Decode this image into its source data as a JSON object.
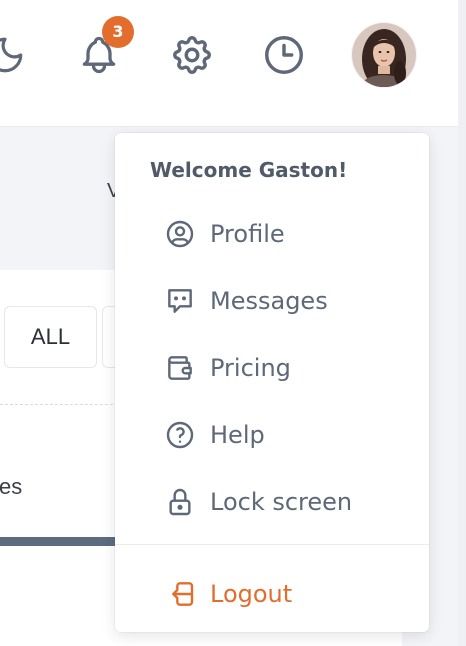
{
  "header": {
    "notifications_count": "3",
    "icons": [
      "moon-icon",
      "bell-icon",
      "gear-icon",
      "clock-icon"
    ],
    "accent_color": "#e36d2d"
  },
  "background": {
    "filter_all_label": "ALL",
    "partial_text": "es",
    "partial_text_top": "V"
  },
  "dropdown": {
    "welcome": "Welcome Gaston!",
    "items": [
      {
        "label": "Profile",
        "icon": "user-circle-icon"
      },
      {
        "label": "Messages",
        "icon": "message-dots-icon"
      },
      {
        "label": "Pricing",
        "icon": "wallet-icon"
      },
      {
        "label": "Help",
        "icon": "help-circle-icon"
      },
      {
        "label": "Lock screen",
        "icon": "lock-icon"
      }
    ],
    "logout": {
      "label": "Logout",
      "icon": "logout-icon"
    }
  }
}
